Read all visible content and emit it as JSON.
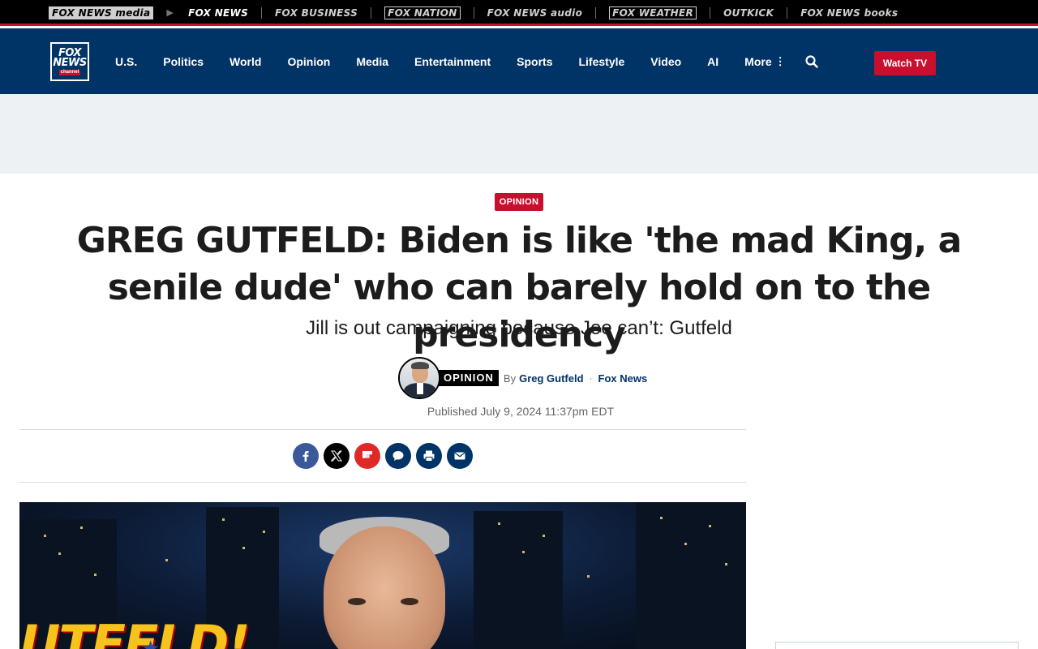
{
  "network_bar": {
    "items": [
      {
        "label": "FOX NEWS media",
        "active": false
      },
      {
        "label": "FOX NEWS",
        "active": true
      },
      {
        "label": "FOX BUSINESS",
        "active": false
      },
      {
        "label": "FOX NATION",
        "active": false
      },
      {
        "label": "FOX NEWS audio",
        "active": false
      },
      {
        "label": "FOX WEATHER",
        "active": false
      },
      {
        "label": "OUTKICK",
        "active": false
      },
      {
        "label": "FOX NEWS books",
        "active": false
      }
    ]
  },
  "header": {
    "logo": {
      "line1": "FOX",
      "line2": "NEWS",
      "line3": "channel"
    },
    "nav": [
      "U.S.",
      "Politics",
      "World",
      "Opinion",
      "Media",
      "Entertainment",
      "Sports",
      "Lifestyle",
      "Video",
      "AI"
    ],
    "more_label": "More",
    "watch_label": "Watch TV",
    "icons": {
      "search": "search-icon",
      "more": "vertical-dots-icon"
    }
  },
  "article": {
    "kicker": "OPINION",
    "headline": "GREG GUTFELD: Biden is like 'the mad King, a senile dude' who can barely hold on to the presidency",
    "subhead": "Jill is out campaigning because Joe can’t: Gutfeld",
    "byline": {
      "tag": "OPINION",
      "by": "By",
      "author": "Greg Gutfeld",
      "separator": "·",
      "source": "Fox News"
    },
    "published_label": "Published",
    "published_date": "July 9, 2024 11:37pm EDT"
  },
  "share": {
    "buttons": [
      {
        "name": "facebook",
        "icon": "facebook-icon"
      },
      {
        "name": "twitter",
        "icon": "x-twitter-icon"
      },
      {
        "name": "flipboard",
        "icon": "flipboard-icon"
      },
      {
        "name": "comments",
        "icon": "comment-icon"
      },
      {
        "name": "print",
        "icon": "print-icon"
      },
      {
        "name": "email",
        "icon": "email-icon"
      }
    ]
  },
  "colors": {
    "brand_navy": "#003366",
    "brand_red": "#c8102e",
    "ad_band": "#edf1f4"
  }
}
